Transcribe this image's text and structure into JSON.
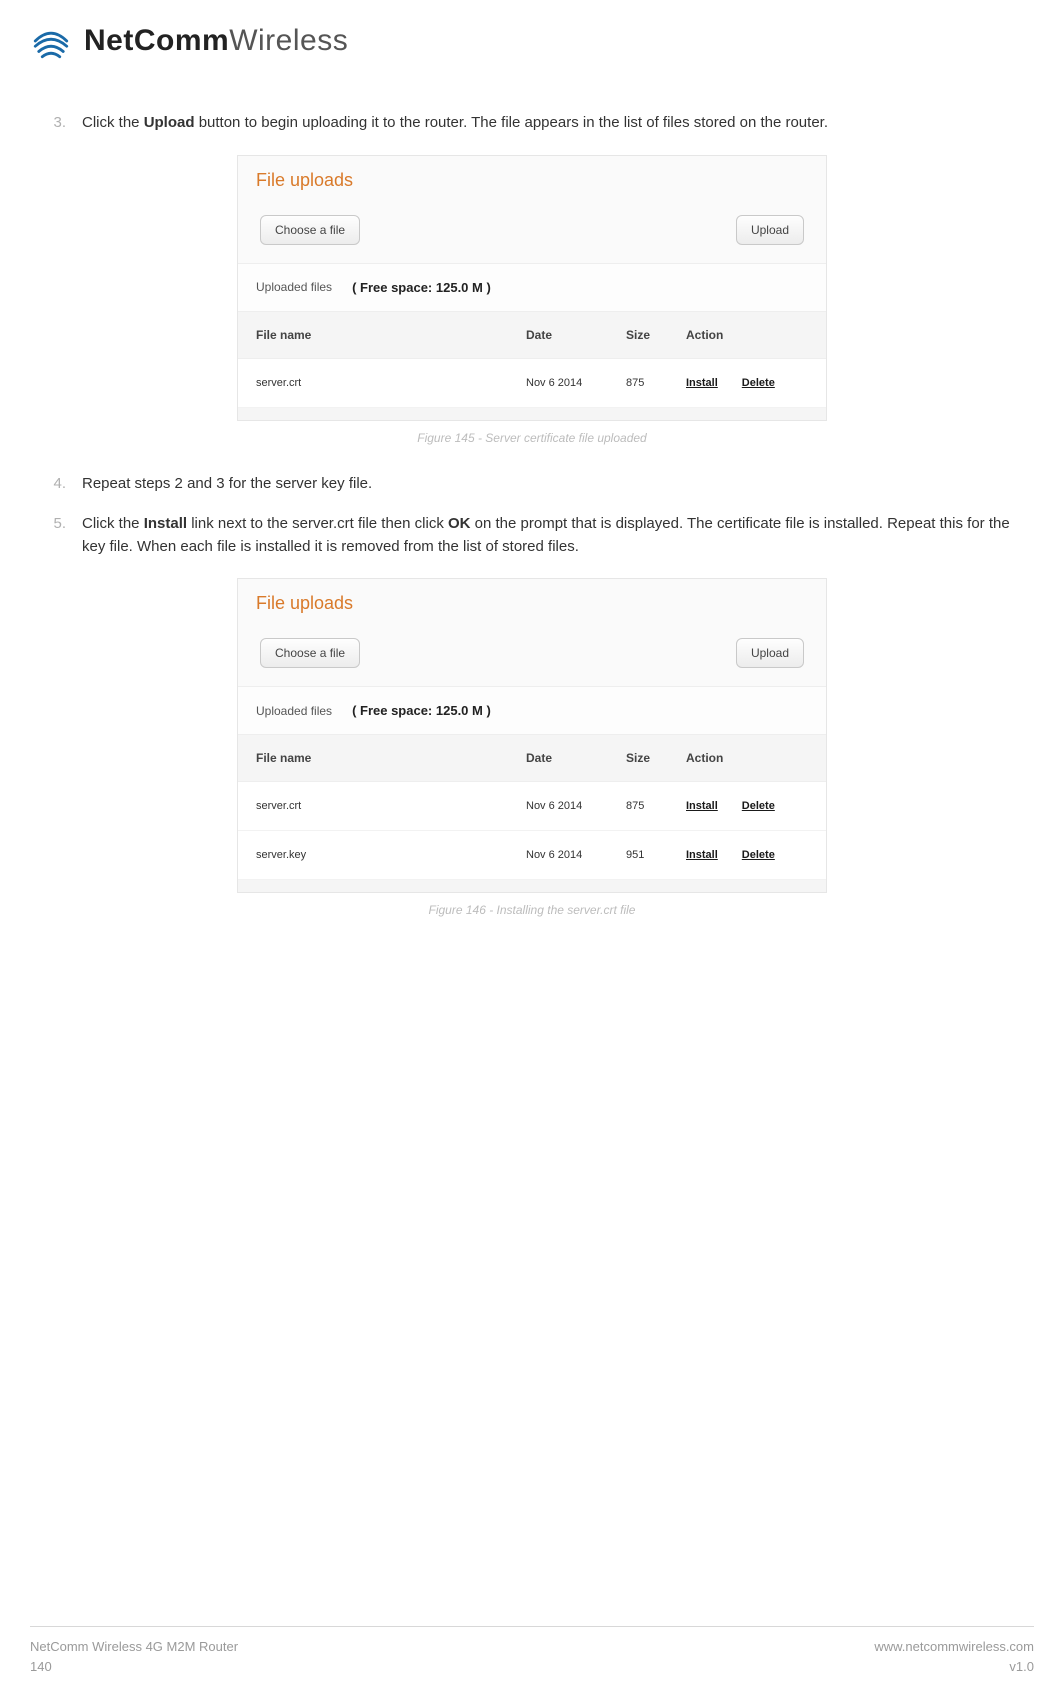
{
  "header": {
    "brand_bold": "NetComm",
    "brand_light": "Wireless"
  },
  "steps": {
    "s3_num": "3.",
    "s3_a": "Click the ",
    "s3_b": "Upload",
    "s3_c": " button to begin uploading it to the router. The file appears in the list of files stored on the router.",
    "s4_num": "4.",
    "s4_text": "Repeat steps 2 and 3 for the server key file.",
    "s5_num": "5.",
    "s5_a": "Click the ",
    "s5_b": "Install",
    "s5_c": " link next to the server.crt file then click ",
    "s5_d": "OK",
    "s5_e": " on the prompt that is displayed. The certificate file is installed. Repeat this for the key file. When each file is installed it is removed from the list of stored files."
  },
  "panel1": {
    "title": "File uploads",
    "choose": "Choose a file",
    "upload": "Upload",
    "uploaded_label": "Uploaded files",
    "freespace": "( Free space: 125.0 M )",
    "cols": {
      "name": "File name",
      "date": "Date",
      "size": "Size",
      "action": "Action"
    },
    "rows": [
      {
        "name": "server.crt",
        "date": "Nov 6 2014",
        "size": "875",
        "install": "Install",
        "delete": "Delete"
      }
    ],
    "caption": "Figure 145 - Server certificate file uploaded"
  },
  "panel2": {
    "title": "File uploads",
    "choose": "Choose a file",
    "upload": "Upload",
    "uploaded_label": "Uploaded files",
    "freespace": "( Free space: 125.0 M )",
    "cols": {
      "name": "File name",
      "date": "Date",
      "size": "Size",
      "action": "Action"
    },
    "rows": [
      {
        "name": "server.crt",
        "date": "Nov 6 2014",
        "size": "875",
        "install": "Install",
        "delete": "Delete"
      },
      {
        "name": "server.key",
        "date": "Nov 6 2014",
        "size": "951",
        "install": "Install",
        "delete": "Delete"
      }
    ],
    "caption": "Figure 146 - Installing the server.crt file"
  },
  "footer": {
    "product": "NetComm Wireless 4G M2M Router",
    "page": "140",
    "url": "www.netcommwireless.com",
    "version": "v1.0"
  }
}
